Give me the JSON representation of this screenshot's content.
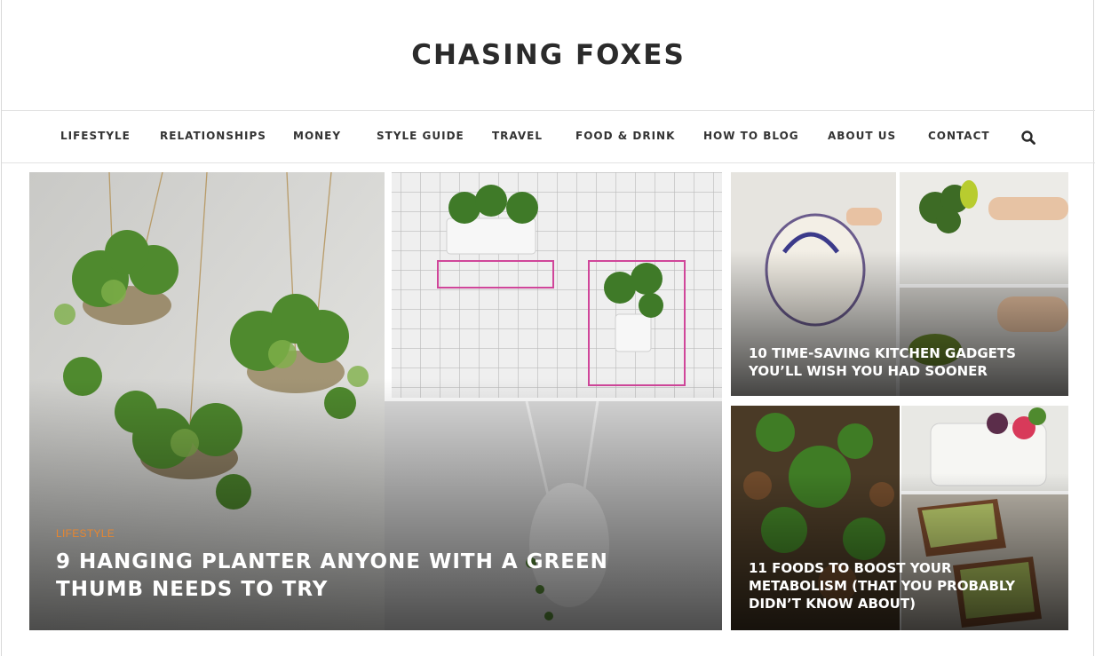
{
  "site": {
    "title": "CHASING FOXES"
  },
  "nav": {
    "items": [
      {
        "label": "LIFESTYLE"
      },
      {
        "label": "RELATIONSHIPS"
      },
      {
        "label": "MONEY"
      },
      {
        "label": "STYLE GUIDE"
      },
      {
        "label": "TRAVEL"
      },
      {
        "label": "FOOD & DRINK"
      },
      {
        "label": "HOW TO BLOG"
      },
      {
        "label": "ABOUT US"
      },
      {
        "label": "CONTACT"
      }
    ],
    "search_icon": "search-icon"
  },
  "featured": {
    "main": {
      "category": "LIFESTYLE",
      "title": "9 HANGING PLANTER ANYONE WITH A GREEN THUMB NEEDS TO TRY"
    },
    "side": [
      {
        "title": "10 TIME-SAVING KITCHEN GADGETS YOU’LL WISH YOU HAD SOONER"
      },
      {
        "title": "11 FOODS TO BOOST YOUR METABOLISM (THAT YOU PROBABLY DIDN’T KNOW ABOUT)"
      }
    ]
  },
  "colors": {
    "category_accent": "#e8862f",
    "text_dark": "#2b2b2b"
  }
}
